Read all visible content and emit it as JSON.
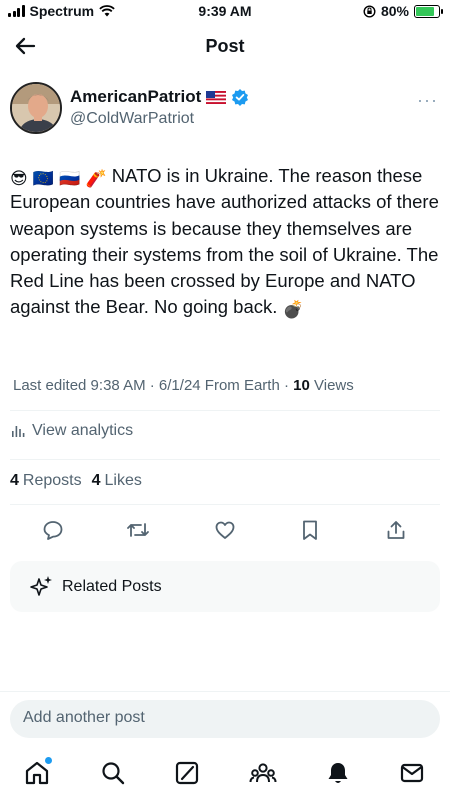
{
  "status_bar": {
    "carrier": "Spectrum",
    "time": "9:39 AM",
    "battery": "80%",
    "battery_level": 0.8
  },
  "header": {
    "title": "Post",
    "back_icon": "arrow-left-icon"
  },
  "author": {
    "display_name": "AmericanPatriot",
    "handle": "@ColdWarPatriot",
    "flag": "us-flag",
    "verified": true,
    "more_label": "···"
  },
  "tweet": {
    "emojis": [
      "😎",
      "🇪🇺",
      "🇷🇺",
      "🧨"
    ],
    "text": " NATO is in Ukraine. The reason these European countries have authorized attacks of there weapon systems is because they themselves are operating their systems from the soil of Ukraine. The Red Line has been crossed by Europe and NATO against the Bear. No going back. ",
    "trailing_emoji": "💣"
  },
  "meta": {
    "edited": "Last edited 9:38 AM · 6/1/24",
    "location": "From Earth",
    "separator": "·",
    "views_count": "10",
    "views_label": "Views"
  },
  "analytics": {
    "label": "View analytics"
  },
  "stats": {
    "reposts_count": "4",
    "reposts_label": "Reposts",
    "likes_count": "4",
    "likes_label": "Likes"
  },
  "actions": [
    "reply-icon",
    "repost-icon",
    "like-icon",
    "bookmark-icon",
    "share-icon"
  ],
  "related": {
    "label": "Related Posts"
  },
  "reply": {
    "placeholder": "Add another post"
  },
  "tabs": [
    "home-icon",
    "search-icon",
    "grok-icon",
    "communities-icon",
    "notifications-icon",
    "messages-icon"
  ],
  "colors": {
    "accent": "#1d9bf0",
    "text": "#0f1419",
    "secondary": "#536471"
  }
}
